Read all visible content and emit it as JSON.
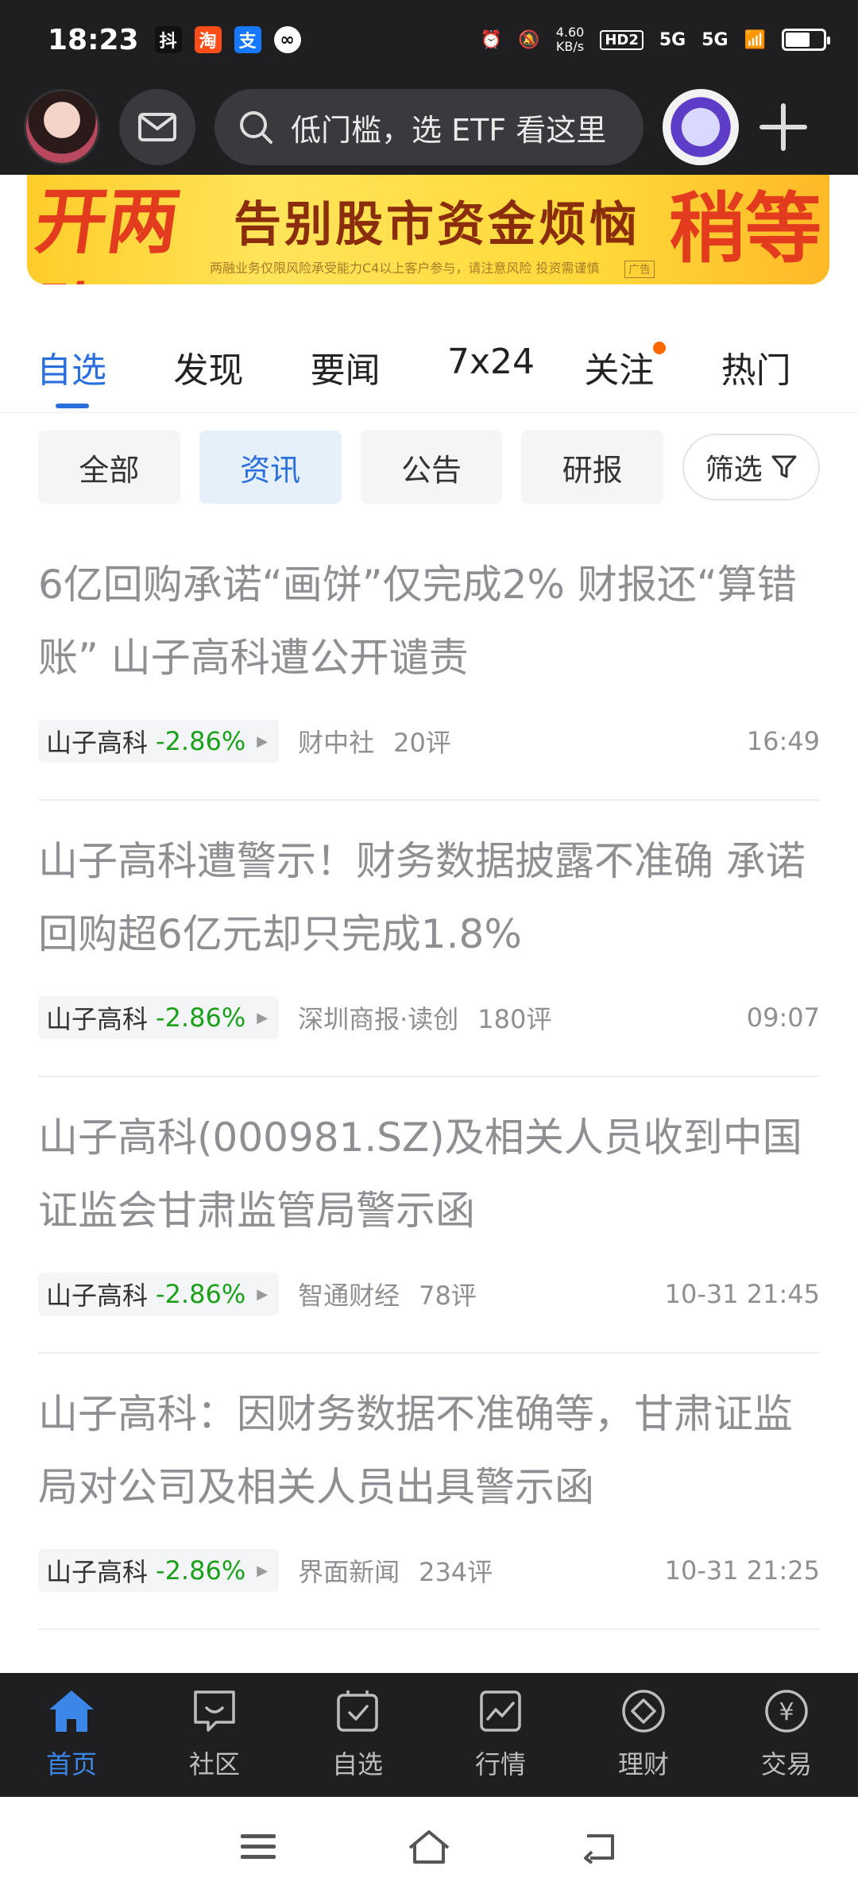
{
  "status_bar": {
    "time": "18:23",
    "apps": [
      "抖",
      "淘",
      "支",
      "∞"
    ],
    "net_speed_value": "4.60",
    "net_speed_unit": "KB/s",
    "hd": "HD2",
    "signal1": "5G",
    "signal2": "5G"
  },
  "header": {
    "search_placeholder": "低门槛，选 ETF 看这里"
  },
  "banner": {
    "left_text": "开两融",
    "main_text": "告别股市资金烦恼",
    "right_text": "稍等",
    "note": "两融业务仅限风险承受能力C4以上客户参与，请注意风险 投资需谨慎",
    "ad_tag": "广告"
  },
  "tabs": [
    {
      "label": "自选",
      "active": true
    },
    {
      "label": "发现",
      "active": false
    },
    {
      "label": "要闻",
      "active": false
    },
    {
      "label": "7x24",
      "active": false
    },
    {
      "label": "关注",
      "active": false,
      "dot": true
    },
    {
      "label": "热门",
      "active": false
    }
  ],
  "chips": [
    {
      "label": "全部",
      "active": false
    },
    {
      "label": "资讯",
      "active": true
    },
    {
      "label": "公告",
      "active": false
    },
    {
      "label": "研报",
      "active": false
    }
  ],
  "filter_label": "筛选",
  "articles": [
    {
      "headline": "6亿回购承诺“画饼”仅完成2% 财报还“算错账” 山子高科遭公开谴责",
      "stock": "山子高科",
      "change": "-2.86%",
      "source": "财中社",
      "comments": "20评",
      "time": "16:49"
    },
    {
      "headline": "山子高科遭警示！财务数据披露不准确 承诺回购超6亿元却只完成1.8%",
      "stock": "山子高科",
      "change": "-2.86%",
      "source": "深圳商报·读创",
      "comments": "180评",
      "time": "09:07"
    },
    {
      "headline": "山子高科(000981.SZ)及相关人员收到中国证监会甘肃监管局警示函",
      "stock": "山子高科",
      "change": "-2.86%",
      "source": "智通财经",
      "comments": "78评",
      "time": "10-31 21:45"
    },
    {
      "headline": "山子高科：因财务数据不准确等，甘肃证监局对公司及相关人员出具警示函",
      "stock": "山子高科",
      "change": "-2.86%",
      "source": "界面新闻",
      "comments": "234评",
      "time": "10-31 21:25"
    }
  ],
  "bottom_nav": [
    {
      "label": "首页",
      "icon": "home-icon",
      "active": true
    },
    {
      "label": "社区",
      "icon": "community-icon",
      "active": false
    },
    {
      "label": "自选",
      "icon": "watchlist-icon",
      "active": false
    },
    {
      "label": "行情",
      "icon": "market-icon",
      "active": false
    },
    {
      "label": "理财",
      "icon": "wealth-icon",
      "active": false
    },
    {
      "label": "交易",
      "icon": "trade-icon",
      "active": false
    }
  ],
  "colors": {
    "accent": "#2a6fdc",
    "down_green": "#1aa01a",
    "header_bg": "#1f1f22",
    "dot_orange": "#ff6a00"
  }
}
